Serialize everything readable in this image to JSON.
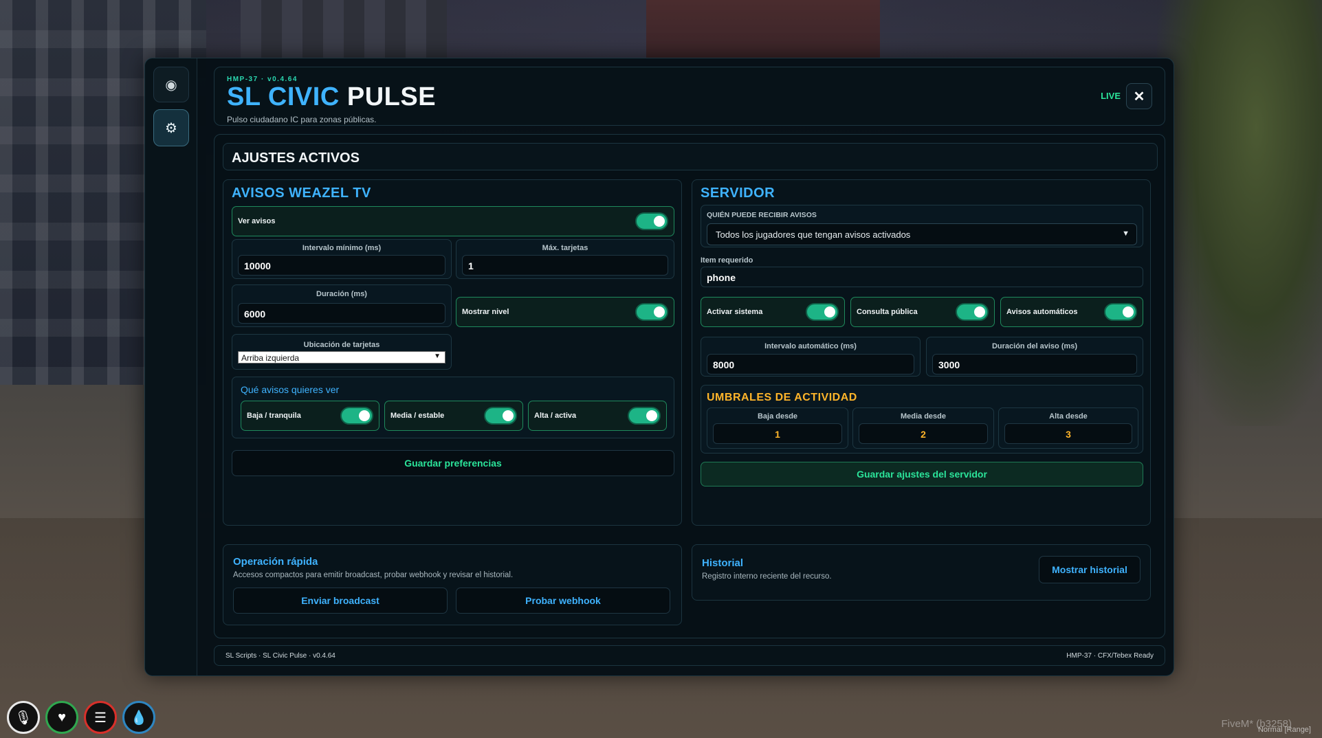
{
  "header": {
    "version": "HMP-37 · v0.4.64",
    "title_part1": "SL CIVIC",
    "title_part2": "PULSE",
    "subtitle": "Pulso ciudadano IC para zonas públicas.",
    "live": "LIVE",
    "close": "✕"
  },
  "sidebar": {
    "items": [
      {
        "icon": "eye-icon",
        "glyph": "◉"
      },
      {
        "icon": "gear-icon",
        "glyph": "⚙",
        "active": true
      }
    ]
  },
  "section_title": "AJUSTES ACTIVOS",
  "weazel": {
    "title": "AVISOS WEAZEL TV",
    "ver_avisos": {
      "label": "Ver avisos",
      "on": true
    },
    "intervalo": {
      "label": "Intervalo mínimo (ms)",
      "value": "10000"
    },
    "max_tarjetas": {
      "label": "Máx. tarjetas",
      "value": "1"
    },
    "duracion": {
      "label": "Duración (ms)",
      "value": "6000"
    },
    "mostrar_nivel": {
      "label": "Mostrar nivel",
      "on": true
    },
    "ubicacion": {
      "label": "Ubicación de tarjetas",
      "value": "Arriba izquierda"
    },
    "que_avisos": {
      "title": "Qué avisos quieres ver",
      "items": [
        {
          "label": "Baja / tranquila",
          "on": true
        },
        {
          "label": "Media / estable",
          "on": true
        },
        {
          "label": "Alta / activa",
          "on": true
        }
      ]
    },
    "guardar": "Guardar preferencias"
  },
  "servidor": {
    "title": "SERVIDOR",
    "quien": {
      "label": "QUIÉN PUEDE RECIBIR AVISOS",
      "value": "Todos los jugadores que tengan avisos activados"
    },
    "item": {
      "label": "Item requerido",
      "value": "phone"
    },
    "toggles": [
      {
        "label": "Activar sistema",
        "on": true
      },
      {
        "label": "Consulta pública",
        "on": true
      },
      {
        "label": "Avisos automáticos",
        "on": true
      }
    ],
    "intervalo_auto": {
      "label": "Intervalo automático (ms)",
      "value": "8000"
    },
    "duracion_aviso": {
      "label": "Duración del aviso (ms)",
      "value": "3000"
    },
    "umbrales": {
      "title": "UMBRALES DE ACTIVIDAD",
      "items": [
        {
          "label": "Baja desde",
          "value": "1"
        },
        {
          "label": "Media desde",
          "value": "2"
        },
        {
          "label": "Alta desde",
          "value": "3"
        }
      ]
    },
    "guardar": "Guardar ajustes del servidor"
  },
  "operacion": {
    "title": "Operación rápida",
    "desc": "Accesos compactos para emitir broadcast, probar webhook y revisar el historial.",
    "broadcast": "Enviar broadcast",
    "webhook": "Probar webhook"
  },
  "historial": {
    "title": "Historial",
    "desc": "Registro interno reciente del recurso.",
    "button": "Mostrar historial"
  },
  "footer": {
    "left": "SL Scripts · SL Civic Pulse · v0.4.64",
    "right": "HMP-37 · CFX/Tebex Ready"
  },
  "hud": {
    "icons": [
      {
        "name": "microphone-icon",
        "glyph": "🎙",
        "ring": "#e8e8e8"
      },
      {
        "name": "heart-icon",
        "glyph": "♥",
        "ring": "#2fa84f"
      },
      {
        "name": "food-icon",
        "glyph": "☰",
        "ring": "#d9302a"
      },
      {
        "name": "water-icon",
        "glyph": "💧",
        "ring": "#2e86c1"
      }
    ],
    "watermark": "FiveM* (b3258)",
    "mode": "Normal [Range]"
  }
}
